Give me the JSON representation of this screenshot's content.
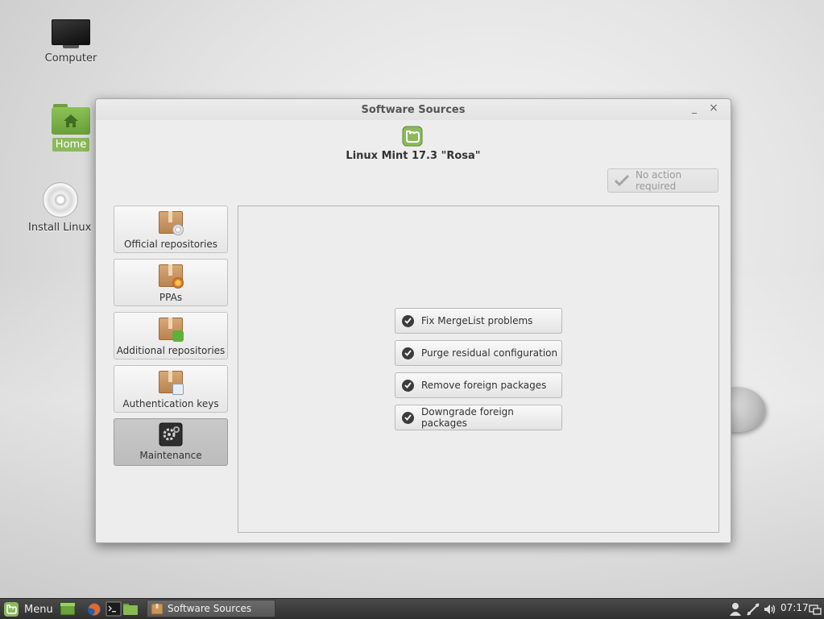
{
  "desktop": {
    "icons": [
      {
        "label": "Computer"
      },
      {
        "label": "Home"
      },
      {
        "label": "Install Linux M"
      }
    ]
  },
  "window": {
    "title": "Software Sources",
    "minimize_glyph": "_",
    "close_glyph": "×",
    "header": {
      "distro_name": "Linux Mint 17.3 \"Rosa\""
    },
    "status_button": {
      "label": "No action required",
      "enabled": false
    },
    "sidebar": {
      "items": [
        {
          "label": "Official repositories",
          "icon": "package-disc-icon",
          "active": false
        },
        {
          "label": "PPAs",
          "icon": "package-ppa-icon",
          "active": false
        },
        {
          "label": "Additional repositories",
          "icon": "package-download-icon",
          "active": false
        },
        {
          "label": "Authentication keys",
          "icon": "package-key-icon",
          "active": false
        },
        {
          "label": "Maintenance",
          "icon": "maintenance-gear-icon",
          "active": true
        }
      ]
    },
    "maintenance": {
      "actions": [
        {
          "label": "Fix MergeList problems"
        },
        {
          "label": "Purge residual configuration"
        },
        {
          "label": "Remove foreign packages"
        },
        {
          "label": "Downgrade foreign packages"
        }
      ]
    }
  },
  "taskbar": {
    "menu_label": "Menu",
    "task_label": "Software Sources",
    "clock": "07:17"
  },
  "colors": {
    "mint_green": "#8cba5a",
    "selected_tab": "#bcbcbc",
    "taskbar": "#3a3a3a"
  }
}
